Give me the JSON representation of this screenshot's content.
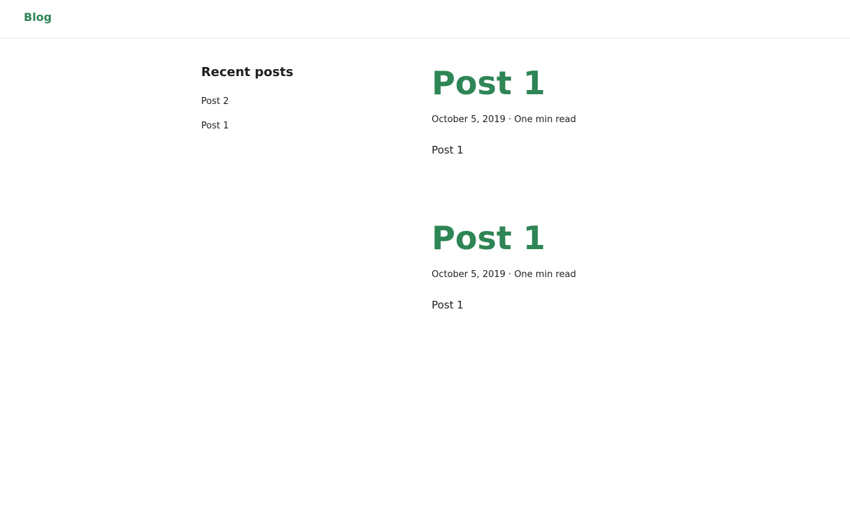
{
  "navbar": {
    "brand": "Blog"
  },
  "sidebar": {
    "title": "Recent posts",
    "items": [
      {
        "label": "Post 2"
      },
      {
        "label": "Post 1"
      }
    ]
  },
  "posts": [
    {
      "title": "Post 1",
      "date": "October 5, 2019",
      "separator": "·",
      "read_time": "One min read",
      "body": "Post 1"
    },
    {
      "title": "Post 1",
      "date": "October 5, 2019",
      "separator": "·",
      "read_time": "One min read",
      "body": "Post 1"
    }
  ],
  "colors": {
    "accent": "#2e8555",
    "text": "#1c1e21",
    "border": "#e8e8e8"
  }
}
